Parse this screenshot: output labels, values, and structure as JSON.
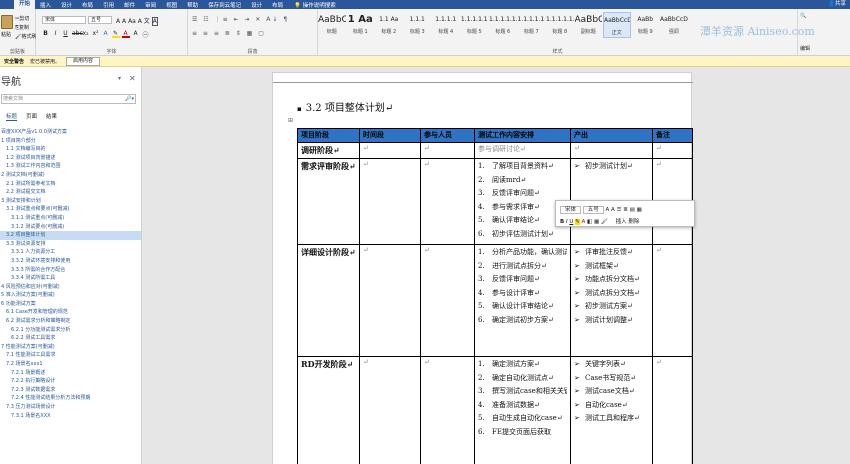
{
  "tabs": [
    "开始",
    "插入",
    "设计",
    "布局",
    "引用",
    "邮件",
    "审阅",
    "视图",
    "帮助",
    "保存到云笔记",
    "设计",
    "布局"
  ],
  "tab_search": "操作说明搜索",
  "share": "共享",
  "clipboard": {
    "paste": "粘贴",
    "cut": "剪切",
    "copy": "复制",
    "format_painter": "格式刷",
    "label": "剪贴板"
  },
  "font": {
    "name": "宋体",
    "size": "五号",
    "label": "字体"
  },
  "paragraph_label": "段落",
  "styles": {
    "label": "样式",
    "items": [
      {
        "preview": "AaBbC",
        "name": "标题"
      },
      {
        "preview": "1 Aa",
        "name": "标题 1"
      },
      {
        "preview": "1.1 Aa",
        "name": "标题 2"
      },
      {
        "preview": "1.1.1",
        "name": "标题 3"
      },
      {
        "preview": "1.1.1.1",
        "name": "标题 4"
      },
      {
        "preview": "1.1.1.1.1",
        "name": "标题 5"
      },
      {
        "preview": "1.1.1.1.1.1",
        "name": "标题 6"
      },
      {
        "preview": "1.1.1.1.1.1",
        "name": "标题 7"
      },
      {
        "preview": "1.1.1.1.1.1",
        "name": "标题 8"
      },
      {
        "preview": "AaBbC",
        "name": "副标题"
      },
      {
        "preview": "AaBbCcDc",
        "name": "正文"
      },
      {
        "preview": "AaBb",
        "name": "标题 9"
      },
      {
        "preview": "AaBbCcD",
        "name": "强调"
      }
    ]
  },
  "editing_label": "编辑",
  "watermark": "潭羊资源  Ainiseo.com",
  "message_bar": {
    "title": "安全警告",
    "text": "宏已被禁用。",
    "button": "启用内容"
  },
  "nav": {
    "title": "导航",
    "search_placeholder": "搜索文档",
    "tabs": [
      "标题",
      "页面",
      "结果"
    ],
    "items": [
      "百度XXX产品v1.0.0测试方案",
      "1 项目简介部分",
      "1.1 文档编写目的",
      "1.2 测试项目背景描述",
      "1.3 测试工作内容和范围",
      "2 测试文档(可删减)",
      "2.1 测试所需参考文档",
      "2.2 测试提交文档",
      "3 测试安排和计划",
      "3.1 测试重点和要点(可删减)",
      "3.1.1 测试重点(可删减)",
      "3.1.2 测试要点(可删减)",
      "3.2 项目整体计划",
      "3.3 测试资源安排",
      "3.3.1 人力资源分工",
      "3.3.2 测试环境安排和使用",
      "3.3.3 所需的合作方配合",
      "3.3.4 测试所需工具",
      "4 风险预估和应对(可删减)",
      "5 准入测试方案(可删减)",
      "6 功能测试方案",
      "6.1 Case开发和管理的规范",
      "6.2 测试需求分析和策略制定",
      "6.2.1 分功能测试需求分析",
      "6.2.2 测试工具需求",
      "7 性能测试方案(可删减)",
      "7.1 性能测试工具需求",
      "7.2 场景名xxx1",
      "7.2.1 场景概述",
      "7.2.2 执行策略设计",
      "7.2.3 测试数据需求",
      "7.2.4 性能测试结果分析方法和预期",
      "7.3 压力测试场景设计",
      "7.3.1 场景名XXX"
    ]
  },
  "doc": {
    "heading_bullet": "▪",
    "heading": "3.2 项目整体计划↵",
    "table": {
      "headers": [
        "项目阶段",
        "时间段",
        "参与人员",
        "测试工作内容安排",
        "产出",
        "备注"
      ],
      "rows": [
        {
          "stage": "调研阶段↵",
          "time": "↵",
          "people": "↵",
          "work": "参与调研讨论↵",
          "output": "↵",
          "note": "↵"
        },
        {
          "stage": "需求评审阶段↵",
          "time": "↵",
          "people": "↵",
          "work": [
            "了解项目背景资料↵",
            "阅读mrd↵",
            "反馈评审问题↵",
            "参与需求评审↵",
            "确认评审结论↵",
            "初步评估测试计划↵"
          ],
          "output": [
            "初步测试计划↵"
          ],
          "note": "↵"
        },
        {
          "stage": "详细设计阶段↵",
          "time": "↵",
          "people": "↵",
          "work": [
            "分析产品功能，确认测试需求↵",
            "进行测试点拆分↵",
            "反馈评审问题↵",
            "参与设计评审↵",
            "确认设计评审结论↵",
            "确定测试初步方案↵"
          ],
          "output": [
            "评审批注反馈↵",
            "测试框架↵",
            "功能点拆分文档↵",
            "测试点拆分文档↵",
            "初步测试方案↵",
            "测试计划调整↵"
          ],
          "note": "↵"
        },
        {
          "stage": "RD开发阶段↵",
          "time": "↵",
          "people": "↵",
          "work": [
            "确定测试方案↵",
            "确定自动化测试点↵",
            "撰写测试case和相关关键字↵",
            "准备测试数据↵",
            "自动生成自动化case↵",
            "FE提交页面后获取"
          ],
          "output": [
            "关键字列表↵",
            "Case书写规范↵",
            "测试case文档↵",
            "自动化case↵",
            "测试工具和程序↵"
          ],
          "note": "↵"
        }
      ]
    }
  },
  "mini_toolbar": {
    "font": "宋体",
    "size": "五号",
    "insert": "插入",
    "delete": "删除"
  }
}
